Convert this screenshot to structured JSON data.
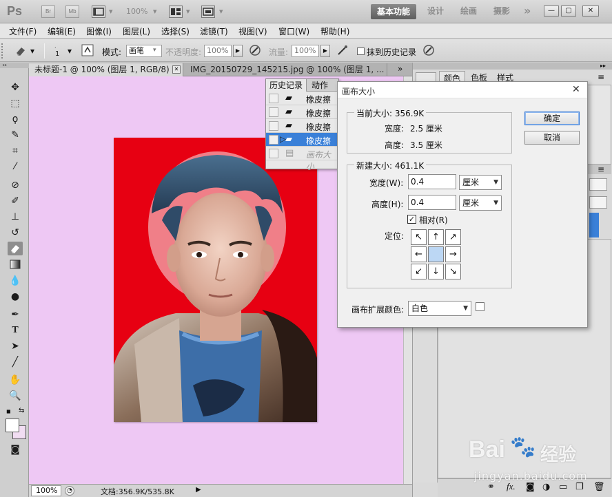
{
  "titlebar": {
    "app": "Ps",
    "bridge": "Br",
    "mini_bridge": "Mb",
    "zoom": "100%",
    "workspaces": [
      "设计",
      "绘画",
      "摄影"
    ],
    "active_workspace": "基本功能",
    "more": "»",
    "minimize": "—",
    "restore": "▢",
    "close": "✕"
  },
  "menu": [
    "文件(F)",
    "编辑(E)",
    "图像(I)",
    "图层(L)",
    "选择(S)",
    "滤镜(T)",
    "视图(V)",
    "窗口(W)",
    "帮助(H)"
  ],
  "options": {
    "brush_size": "1",
    "mode_label": "模式:",
    "mode_value": "画笔",
    "opacity_label": "不透明度:",
    "opacity_value": "100%",
    "flow_label": "流量:",
    "flow_value": "100%",
    "erase_history_label": "抹到历史记录"
  },
  "document": {
    "tabs": [
      {
        "label": "未标题-1 @ 100% (图层 1, RGB/8) *",
        "close": "✕"
      },
      {
        "label": "IMG_20150729_145215.jpg @ 100% (图层 1, ...",
        "close": "»"
      }
    ],
    "status_zoom": "100%",
    "status_doc": "文档:356.9K/535.8K"
  },
  "right_panel": {
    "tabs": [
      "颜色",
      "色板",
      "样式"
    ]
  },
  "history_panel": {
    "tabs": [
      "历史记录",
      "动作"
    ],
    "items": [
      {
        "label": "橡皮擦",
        "selected": false
      },
      {
        "label": "橡皮擦",
        "selected": false
      },
      {
        "label": "橡皮擦",
        "selected": false
      },
      {
        "label": "橡皮擦",
        "selected": true
      },
      {
        "label": "画布大小",
        "selected": false
      }
    ]
  },
  "dialog": {
    "title": "画布大小",
    "current_size_label": "当前大小: 356.9K",
    "width_label": "宽度:",
    "width_value": "2.5 厘米",
    "height_label": "高度:",
    "height_value": "3.5 厘米",
    "new_size_label": "新建大小: 461.1K",
    "new_width_label": "宽度(W):",
    "new_width_value": "0.4",
    "new_height_label": "高度(H):",
    "new_height_value": "0.4",
    "unit": "厘米",
    "relative_label": "相对(R)",
    "anchor_label": "定位:",
    "extension_color_label": "画布扩展颜色:",
    "extension_color_value": "白色",
    "ok": "确定",
    "cancel": "取消"
  },
  "watermark": {
    "brand": "Bai",
    "brand_suffix": "经验",
    "url": "jingyan.baidu.com"
  },
  "colors": {
    "canvas_bg": "#eec8f4",
    "photo_bg": "#e70012",
    "selection": "#3a80d8"
  }
}
